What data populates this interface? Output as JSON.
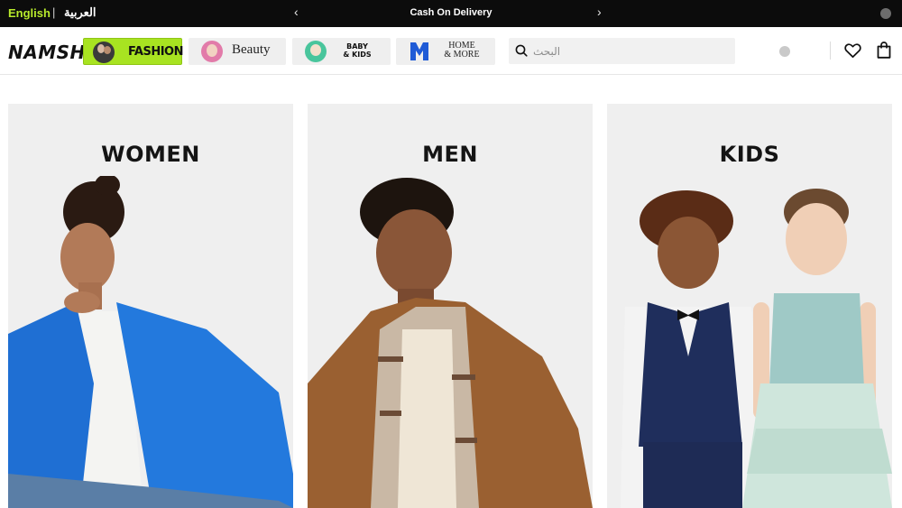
{
  "topbar": {
    "lang_active": "English",
    "lang_separator": "|",
    "lang_alt": "العربية",
    "promo_prev": "‹",
    "promo_text": "Cash On Delivery",
    "promo_next": "›"
  },
  "header": {
    "logo": "NAMSHI",
    "categories": [
      {
        "label": "FASHION",
        "icon": "fashion-thumbnail",
        "accent": "#a8e321",
        "active": true
      },
      {
        "label": "Beauty",
        "icon": "beauty-thumbnail",
        "active": false
      },
      {
        "label": "BABY & KIDS",
        "icon": "baby-kids-thumbnail",
        "active": false
      },
      {
        "label": "HOME & MORE",
        "icon": "home-more-logo",
        "active": false
      }
    ],
    "kids_line1": "BABY",
    "kids_line2": "& KIDS",
    "home_line1": "HOME",
    "home_line2": "& MORE",
    "search": {
      "placeholder": "البحث",
      "value": ""
    },
    "icons": [
      "search-icon",
      "wishlist-heart-icon",
      "shopping-bag-icon"
    ]
  },
  "cards": [
    {
      "title": "WOMEN"
    },
    {
      "title": "MEN"
    },
    {
      "title": "KIDS"
    }
  ],
  "colors": {
    "topbar_bg": "#0c0c0c",
    "accent_lime": "#a8e321",
    "card_bg": "#efefef"
  }
}
